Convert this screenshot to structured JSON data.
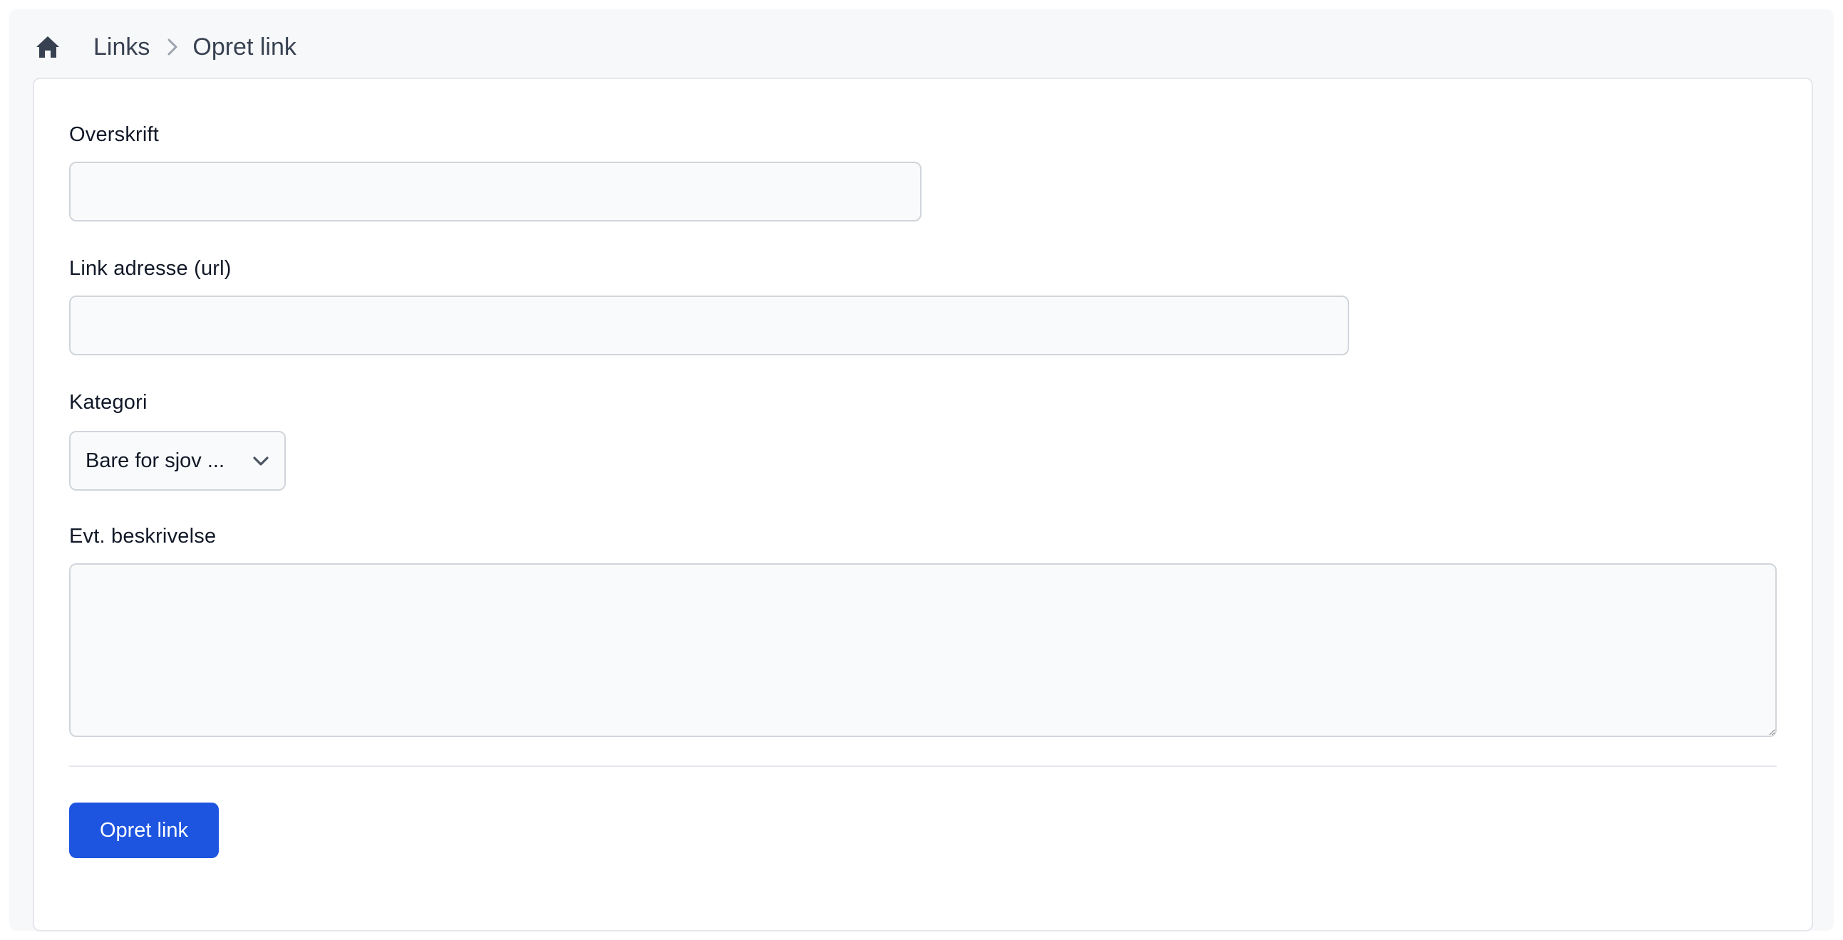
{
  "breadcrumb": {
    "home_icon": "home-icon",
    "links_label": "Links",
    "separator_icon": "chevron-right-icon",
    "current_label": "Opret link"
  },
  "form": {
    "headline_label": "Overskrift",
    "headline_value": "",
    "url_label": "Link adresse (url)",
    "url_value": "",
    "category_label": "Kategori",
    "category_selected": "Bare for sjov ...",
    "category_icon": "chevron-down-icon",
    "description_label": "Evt. beskrivelse",
    "description_value": "",
    "submit_label": "Opret link"
  },
  "colors": {
    "accent": "#1d55e0",
    "page_background": "#f7f8fa",
    "card_background": "#ffffff"
  }
}
